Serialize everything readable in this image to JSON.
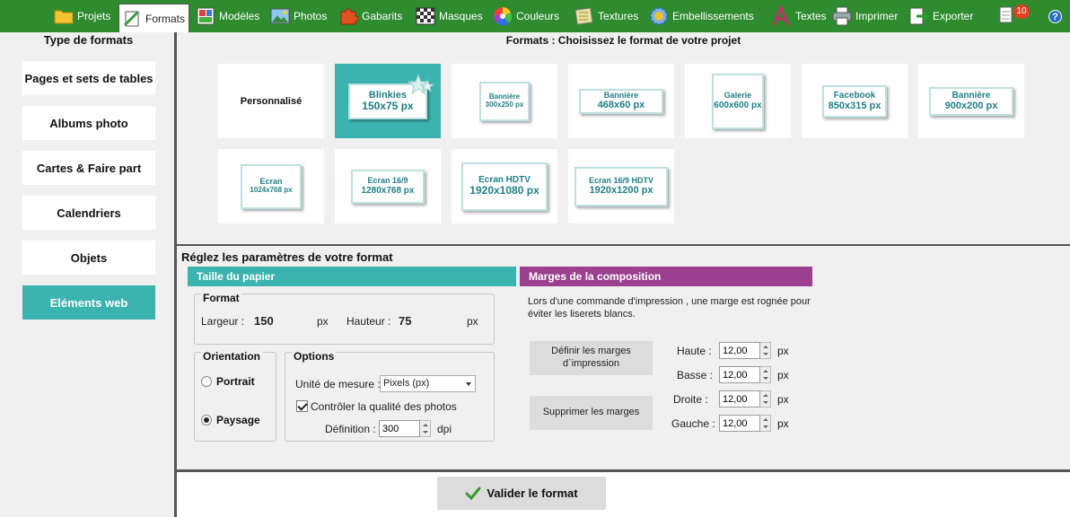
{
  "toolbar": {
    "items": [
      {
        "label": "Projets",
        "icon": "folder-icon"
      },
      {
        "label": "Formats",
        "icon": "formats-icon"
      },
      {
        "label": "Modèles",
        "icon": "templates-icon"
      },
      {
        "label": "Photos",
        "icon": "photo-icon"
      },
      {
        "label": "Gabarits",
        "icon": "puzzle-icon"
      },
      {
        "label": "Masques",
        "icon": "mask-icon"
      },
      {
        "label": "Couleurs",
        "icon": "color-wheel-icon"
      },
      {
        "label": "Textures",
        "icon": "texture-icon"
      },
      {
        "label": "Embellissements",
        "icon": "gear-icon"
      },
      {
        "label": "Textes",
        "icon": "text-a-icon"
      },
      {
        "label": "Imprimer",
        "icon": "printer-icon"
      },
      {
        "label": "Exporter",
        "icon": "export-icon"
      }
    ],
    "notification_count": "10",
    "help": "?",
    "accent": "#2e8b2e"
  },
  "sidebar": {
    "title": "Type de formats",
    "items": [
      {
        "label": "Pages et sets de tables"
      },
      {
        "label": "Albums photo"
      },
      {
        "label": "Cartes & Faire part"
      },
      {
        "label": "Calendriers"
      },
      {
        "label": "Objets"
      },
      {
        "label": "Eléments web"
      }
    ],
    "active_color": "#3bb3ae"
  },
  "formats": {
    "title": "Formats : Choisissez le format de votre projet",
    "cards": [
      {
        "name": "Personnalisé",
        "size": ""
      },
      {
        "name": "Blinkies",
        "size": "150x75 px"
      },
      {
        "name": "Bannière",
        "size": "300x250 px"
      },
      {
        "name": "Bannière",
        "size": "468x60 px"
      },
      {
        "name": "Galerie",
        "size": "600x600 px"
      },
      {
        "name": "Facebook",
        "size": "850x315 px"
      },
      {
        "name": "Bannière",
        "size": "900x200 px"
      },
      {
        "name": "Ecran",
        "size": "1024x768 px"
      },
      {
        "name": "Ecran 16/9",
        "size": "1280x768 px"
      },
      {
        "name": "Ecran HDTV",
        "size": "1920x1080 px"
      },
      {
        "name": "Ecran 16/9 HDTV",
        "size": "1920x1200 px"
      }
    ]
  },
  "params": {
    "title": "Réglez les paramètres de votre format",
    "paper_header": "Taille du papier",
    "margins_header": "Marges de la composition",
    "format_group": "Format",
    "width_label": "Largeur :",
    "width_value": "150",
    "width_unit": "px",
    "height_label": "Hauteur :",
    "height_value": "75",
    "height_unit": "px",
    "orientation_group": "Orientation",
    "portrait": "Portrait",
    "landscape": "Paysage",
    "options_group": "Options",
    "unit_label": "Unité de mesure :",
    "unit_value": "Pixels (px)",
    "quality_label": "Contrôler la qualité des photos",
    "definition_label": "Définition :",
    "definition_value": "300",
    "definition_unit": "dpi",
    "margins_desc": "Lors d'une commande d'impression , une marge est rognée pour éviter les liserets blancs.",
    "define_margins_btn": "Définir les marges d`impression",
    "remove_margins_btn": "Supprimer les marges",
    "margin_top_label": "Haute :",
    "margin_top_value": "12,00",
    "margin_bottom_label": "Basse :",
    "margin_bottom_value": "12,00",
    "margin_right_label": "Droite :",
    "margin_right_value": "12,00",
    "margin_left_label": "Gauche :",
    "margin_left_value": "12,00",
    "margin_unit": "px",
    "teal": "#3bb3ae",
    "purple": "#9c3f8e"
  },
  "footer": {
    "validate_label": "Valider le format"
  }
}
